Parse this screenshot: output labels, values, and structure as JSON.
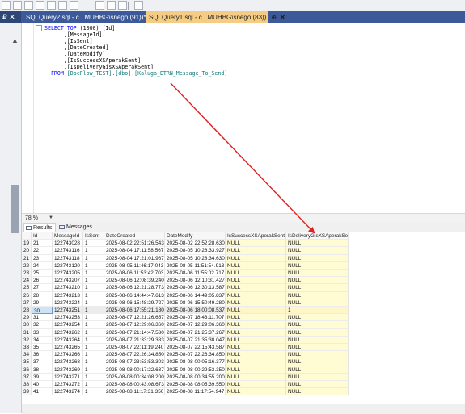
{
  "tabs": [
    {
      "title": "SQLQuery2.sql - c...MUHBG\\snego (91))*"
    },
    {
      "title": "SQLQuery1.sql - c...MUHBG\\snego (83))",
      "pin": "⊕",
      "close": "✕"
    }
  ],
  "left_pin": "₽ ✕",
  "editor": {
    "lines": [
      [
        {
          "t": "SELECT TOP ",
          "c": "kw"
        },
        {
          "t": "(1000) [Id]",
          "c": "txt"
        }
      ],
      [
        {
          "t": "      ,[MessageId]",
          "c": "txt"
        }
      ],
      [
        {
          "t": "      ,[IsSent]",
          "c": "txt"
        }
      ],
      [
        {
          "t": "      ,[DateCreated]",
          "c": "txt"
        }
      ],
      [
        {
          "t": "      ,[DateModify]",
          "c": "txt"
        }
      ],
      [
        {
          "t": "      ,[IsSuccessXSAperakSent]",
          "c": "txt"
        }
      ],
      [
        {
          "t": "      ,[IsDeliveryGisXSAperakSent]",
          "c": "txt"
        }
      ],
      [
        {
          "t": "  FROM ",
          "c": "kw"
        },
        {
          "t": "[DocFlow_TEST].[dbo].[Kaluga_ETRN_Message_To_Send]",
          "c": "ident"
        }
      ]
    ]
  },
  "zoom": "78 %",
  "result_tabs": {
    "results": "Results",
    "messages": "Messages"
  },
  "grid": {
    "columns": [
      "",
      "Id",
      "MessageId",
      "IsSent",
      "DateCreated",
      "DateModify",
      "IsSuccessXSAperakSent",
      "IsDeliveryGisXSAperakSent"
    ],
    "rows": [
      [
        "19",
        "21",
        "122743028",
        "1",
        "2025-08-02 22:51:26.543",
        "2025-08-02 22:52:28.630",
        "NULL",
        "NULL"
      ],
      [
        "20",
        "22",
        "122743116",
        "1",
        "2025-08-04 17:11:58.567",
        "2025-08-05 10:28:33.927",
        "NULL",
        "NULL"
      ],
      [
        "21",
        "23",
        "122743118",
        "1",
        "2025-08-04 17:21:01.987",
        "2025-08-05 10:28:34.630",
        "NULL",
        "NULL"
      ],
      [
        "22",
        "24",
        "122743120",
        "1",
        "2025-08-05 11:46:17.043",
        "2025-08-05 11:51:54.913",
        "NULL",
        "NULL"
      ],
      [
        "23",
        "25",
        "122743205",
        "1",
        "2025-08-06 11:53:42.703",
        "2025-08-06 11:55:02.717",
        "NULL",
        "NULL"
      ],
      [
        "24",
        "26",
        "122743207",
        "1",
        "2025-08-06 12:08:39.240",
        "2025-08-06 12:10:31.427",
        "NULL",
        "NULL"
      ],
      [
        "25",
        "27",
        "122743210",
        "1",
        "2025-08-06 12:21:28.773",
        "2025-08-06 12:30:13.587",
        "NULL",
        "NULL"
      ],
      [
        "26",
        "28",
        "122743213",
        "1",
        "2025-08-06 14:44:47.613",
        "2025-08-06 14:49:05.837",
        "NULL",
        "NULL"
      ],
      [
        "27",
        "29",
        "122743224",
        "1",
        "2025-08-06 15:48:29.727",
        "2025-08-06 15:50:49.280",
        "NULL",
        "NULL"
      ],
      [
        "28",
        "30",
        "122743251",
        "1",
        "2025-08-06 17:55:21.180",
        "2025-08-06 18:00:08.537",
        "NULL",
        "1"
      ],
      [
        "29",
        "31",
        "122743253",
        "1",
        "2025-08-07 12:21:26.657",
        "2025-08-07 18:43:11.707",
        "NULL",
        "NULL"
      ],
      [
        "30",
        "32",
        "122743254",
        "1",
        "2025-08-07 12:29:06.360",
        "2025-08-07 12:29:06.360",
        "NULL",
        "NULL"
      ],
      [
        "31",
        "33",
        "122743262",
        "1",
        "2025-08-07 21:14:47.530",
        "2025-08-07 21:25:37.267",
        "NULL",
        "NULL"
      ],
      [
        "32",
        "34",
        "122743264",
        "1",
        "2025-08-07 21:33:29.383",
        "2025-08-07 21:35:38.047",
        "NULL",
        "NULL"
      ],
      [
        "33",
        "35",
        "122743265",
        "1",
        "2025-08-07 22:11:19.240",
        "2025-08-07 22:15:43.587",
        "NULL",
        "NULL"
      ],
      [
        "34",
        "36",
        "122743266",
        "1",
        "2025-08-07 22:26:34.850",
        "2025-08-07 22:26:34.850",
        "NULL",
        "NULL"
      ],
      [
        "35",
        "37",
        "122743268",
        "1",
        "2025-08-07 23:53:53.303",
        "2025-08-08 00:05:16.377",
        "NULL",
        "NULL"
      ],
      [
        "36",
        "38",
        "122743269",
        "1",
        "2025-08-08 00:17:22.637",
        "2025-08-08 00:29:53.350",
        "NULL",
        "NULL"
      ],
      [
        "37",
        "39",
        "122743271",
        "1",
        "2025-08-08 00:34:08.200",
        "2025-08-08 00:34:55.200",
        "NULL",
        "NULL"
      ],
      [
        "38",
        "40",
        "122743272",
        "1",
        "2025-08-08 00:43:08.673",
        "2025-08-08 08:05:39.550",
        "NULL",
        "NULL"
      ],
      [
        "39",
        "41",
        "122743274",
        "1",
        "2025-08-08 11:17:31.350",
        "2025-08-08 11:17:54.947",
        "NULL",
        "NULL"
      ]
    ],
    "selected_row_index": 9
  },
  "colors": {
    "annotation_arrow": "#e02020",
    "tab_active": "#f5cc84",
    "tab_bar": "#3c5a9a"
  }
}
